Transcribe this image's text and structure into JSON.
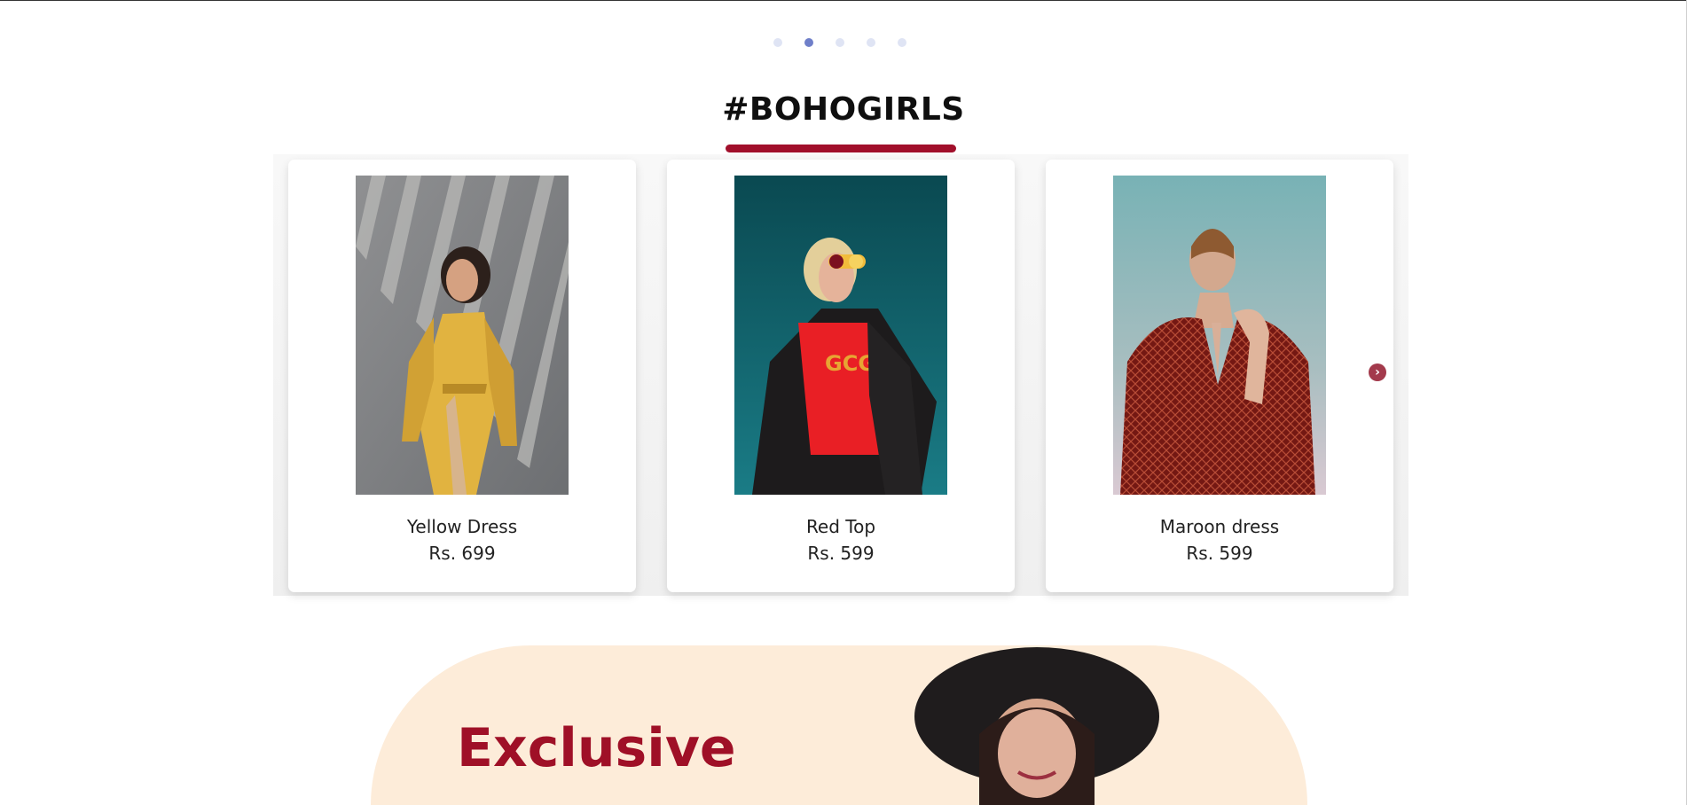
{
  "carousel_indicator": {
    "count": 5,
    "active_index": 1
  },
  "section": {
    "title": "#BOHOGIRLS"
  },
  "products": [
    {
      "name": "Yellow Dress",
      "price": "Rs. 699"
    },
    {
      "name": "Red Top",
      "price": "Rs. 599"
    },
    {
      "name": "Maroon dress",
      "price": "Rs. 599"
    }
  ],
  "navigation": {
    "prev_icon": "chevron-left-icon",
    "next_icon": "chevron-right-icon"
  },
  "promo": {
    "title": "Exclusive"
  },
  "colors": {
    "accent": "#a10f2b",
    "active_dot": "#6f7fc9",
    "inactive_dot": "#dfe4f4",
    "promo_bg": "#fdecd9"
  }
}
